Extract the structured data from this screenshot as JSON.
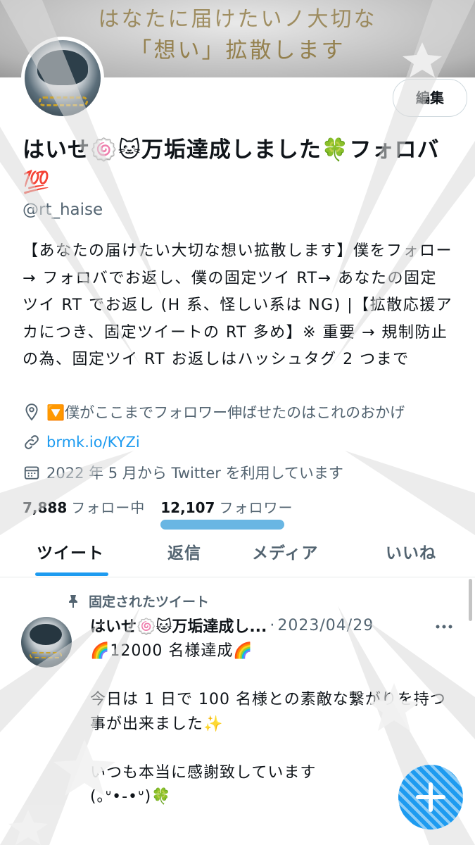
{
  "header": {
    "banner_line1": "はなたに届けたいノ大切な",
    "banner_line2": "「想い」拡散します",
    "edit_label": "編集"
  },
  "profile": {
    "display_name": "はいせ🍥🐱万垢達成しました🍀フォロバ💯",
    "handle": "@rt_haise",
    "bio": "【あなたの届けたい大切な想い拡散します】僕をフォロー → フォロバでお返し、僕の固定ツイ RT→ あなたの固定ツイ RT でお返し (H 系、怪しい系は NG) |【拡散応援アカにつき、固定ツイートの RT 多め】※ 重要 → 規制防止の為、固定ツイ RT お返しはハッシュタグ 2 つまで",
    "location": "🔽僕がここまでフォロワー伸ばせたのはこれのおかげ",
    "link": "brmk.io/KYZi",
    "joined": "2022 年 5 月から Twitter を利用しています",
    "following_count": "7,888",
    "following_label": "フォロー中",
    "followers_count": "12,107",
    "followers_label": "フォロワー"
  },
  "tabs": [
    {
      "label": "ツイート",
      "active": true
    },
    {
      "label": "返信",
      "active": false
    },
    {
      "label": "メディア",
      "active": false
    },
    {
      "label": "いいね",
      "active": false
    }
  ],
  "tweet": {
    "pinned_label": "固定されたツイート",
    "author": "はいせ🍥🐱万垢達成し...",
    "date": "2023/04/29",
    "text": "🌈12000 名様達成🌈\n\n今日は 1 日で 100 名様との素敵な繋がりを持つ事が出来ました✨\n\nいつも本当に感謝致しています\n(｡ᐡ‎•-•ᐡ)🍀"
  },
  "colors": {
    "accent": "#1d9bf0",
    "secondary_text": "#536471",
    "highlight": "#69b6e3"
  },
  "icons": {
    "location": "location-pin-icon",
    "link": "link-icon",
    "calendar": "calendar-icon",
    "pin": "pin-icon",
    "more": "more-icon",
    "compose": "compose-plus-icon"
  }
}
